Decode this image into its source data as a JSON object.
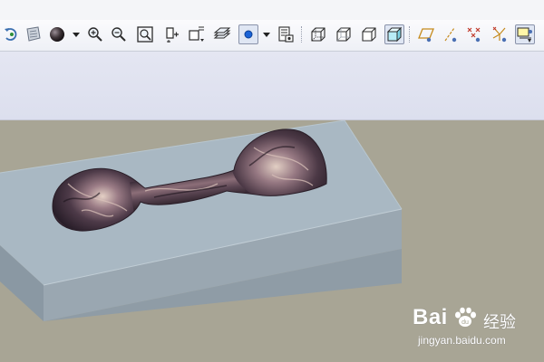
{
  "toolbar": {
    "buttons": [
      {
        "name": "regenerate-icon"
      },
      {
        "name": "model-tree-icon"
      },
      {
        "name": "appearance-icon"
      },
      {
        "name": "zoom-in-icon"
      },
      {
        "name": "zoom-out-icon"
      },
      {
        "name": "refit-icon"
      },
      {
        "name": "reorient-icon"
      },
      {
        "name": "saved-views-icon"
      },
      {
        "name": "layers-icon"
      },
      {
        "name": "display-style-icon",
        "active": true
      },
      {
        "name": "view-manager-icon"
      },
      {
        "name": "wireframe-icon"
      },
      {
        "name": "hidden-line-icon"
      },
      {
        "name": "no-hidden-icon"
      },
      {
        "name": "shading-icon",
        "active": true
      },
      {
        "name": "datum-planes-icon"
      },
      {
        "name": "datum-axes-icon"
      },
      {
        "name": "datum-points-icon"
      },
      {
        "name": "coordinate-systems-icon"
      },
      {
        "name": "annotations-icon",
        "active": true
      }
    ]
  },
  "viewport": {
    "background_color": "#a8a595",
    "block_top_color": "#a9b8c3",
    "block_side_color": "#8d9ba6",
    "block_front_color": "#9aa8b3"
  },
  "watermark": {
    "brand": "Bai",
    "brand_cn": "经验",
    "url": "jingyan.baidu.com"
  }
}
